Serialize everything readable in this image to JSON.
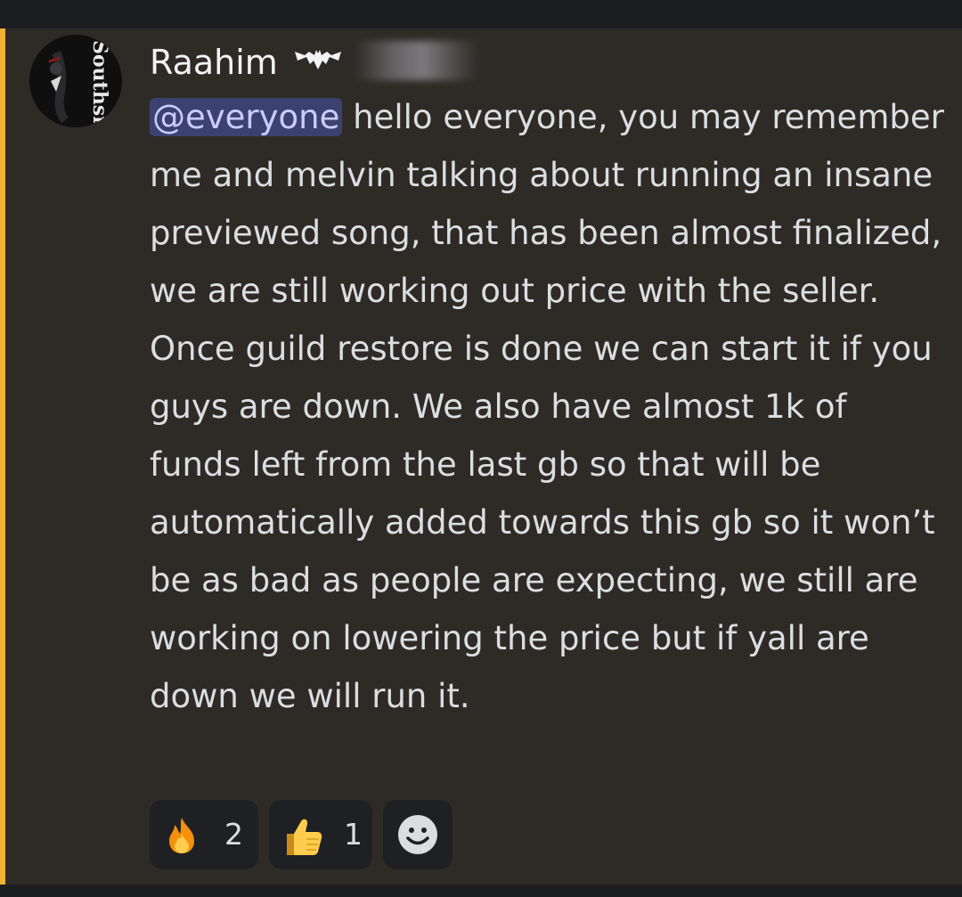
{
  "author": {
    "name": "Raahim",
    "avatar_text": "Southside"
  },
  "message": {
    "mention": "@everyone",
    "text": " hello everyone, you may remember me and melvin talking about running an insane previewed song, that has been almost finalized, we are still working out price with the seller. Once guild restore is done we can start it if you guys are down. We also have almost 1k of funds left from the last gb so that will be automatically added towards this gb so it won’t be as bad as people are expecting, we still are working on lowering the price but if yall are down we will run it."
  },
  "reactions": [
    {
      "emoji": "fire-icon",
      "count": "2"
    },
    {
      "emoji": "thumbs-up-icon",
      "count": "1"
    },
    {
      "emoji": "add-reaction-icon"
    }
  ],
  "colors": {
    "mention_bar": "#f0b232",
    "mention_bg": "#3c4270",
    "message_bg": "#2e2b27"
  }
}
